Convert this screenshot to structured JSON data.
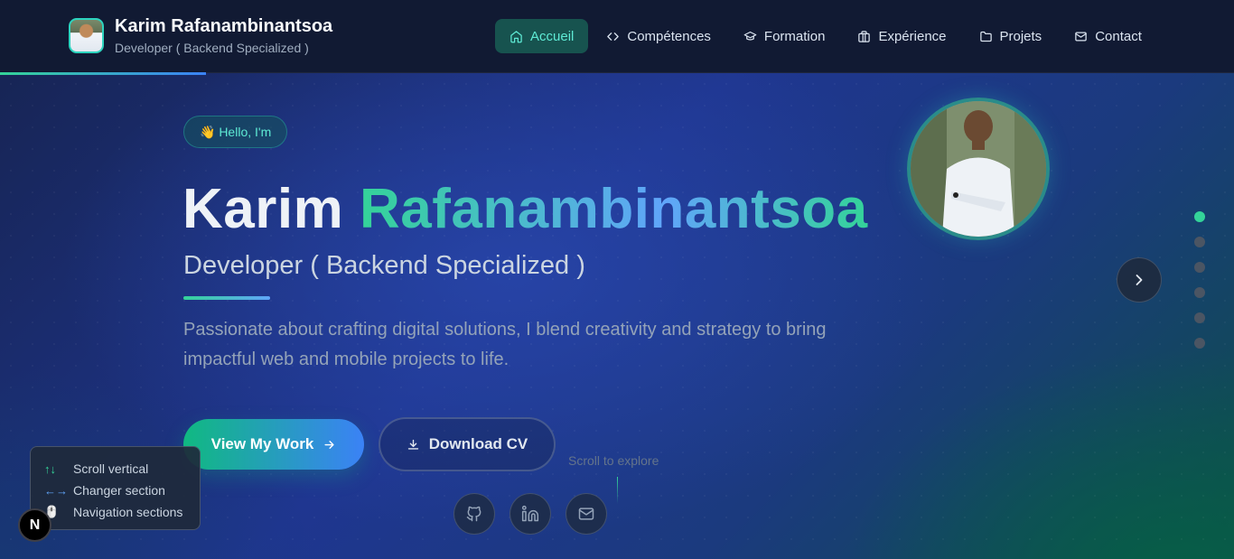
{
  "header": {
    "name": "Karim Rafanambinantsoa",
    "role": "Developer ( Backend Specialized )"
  },
  "nav": [
    {
      "label": "Accueil",
      "icon": "home-icon",
      "active": true
    },
    {
      "label": "Compétences",
      "icon": "code-icon"
    },
    {
      "label": "Formation",
      "icon": "graduation-cap-icon"
    },
    {
      "label": "Expérience",
      "icon": "briefcase-icon"
    },
    {
      "label": "Projets",
      "icon": "folder-icon"
    },
    {
      "label": "Contact",
      "icon": "mail-icon"
    }
  ],
  "scroll_progress": 0.167,
  "hero": {
    "greeting": "👋 Hello, I'm",
    "first_name": "Karim",
    "last_name": "Rafanambinantsoa",
    "role": "Developer ( Backend Specialized )",
    "description": "Passionate about crafting digital solutions, I blend creativity and strategy to bring impactful web and mobile projects to life.",
    "primary_button": "View My Work",
    "secondary_button": "Download CV",
    "scroll_hint": "Scroll to explore"
  },
  "social": [
    "github-icon",
    "linkedin-icon",
    "mail-icon"
  ],
  "sections": {
    "count": 6,
    "active_index": 0
  },
  "hints": [
    {
      "icon": "↑↓",
      "label": "Scroll vertical"
    },
    {
      "icon": "←→",
      "label": "Changer section"
    },
    {
      "icon": "🖱️",
      "label": "Navigation sections"
    }
  ],
  "badge": "N",
  "colors": {
    "accent_green": "#34d399",
    "accent_blue": "#3b82f6",
    "header_bg": "#111a33",
    "active_nav_bg": "#17534f"
  }
}
